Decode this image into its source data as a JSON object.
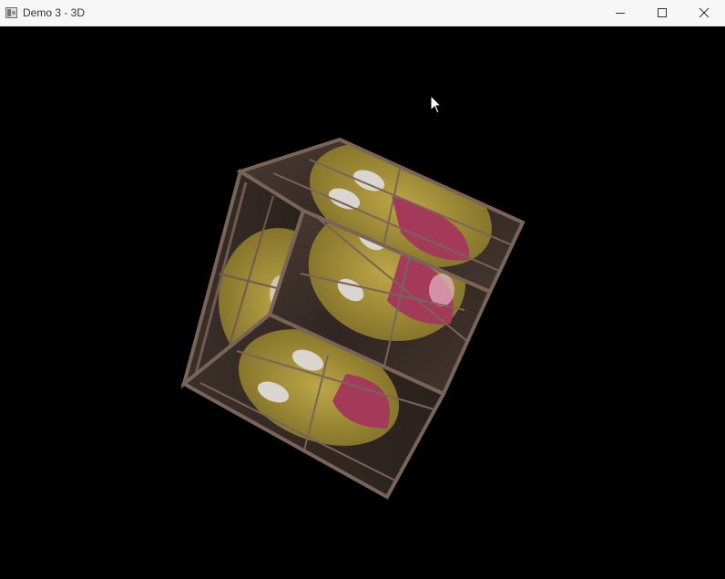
{
  "window": {
    "title": "Demo 3 - 3D",
    "controls": {
      "minimize_icon": "minimize-icon",
      "maximize_icon": "maximize-icon",
      "close_icon": "close-icon"
    }
  },
  "scene": {
    "background_color": "#000000",
    "object": "textured-cube",
    "texture": "wooden-crate-with-smiley-face",
    "colors": {
      "wood_dark": "#3a2e28",
      "wood_light": "#7a6458",
      "smiley_yellow": "#b9a640",
      "mouth_pink": "#a43a5a"
    }
  }
}
